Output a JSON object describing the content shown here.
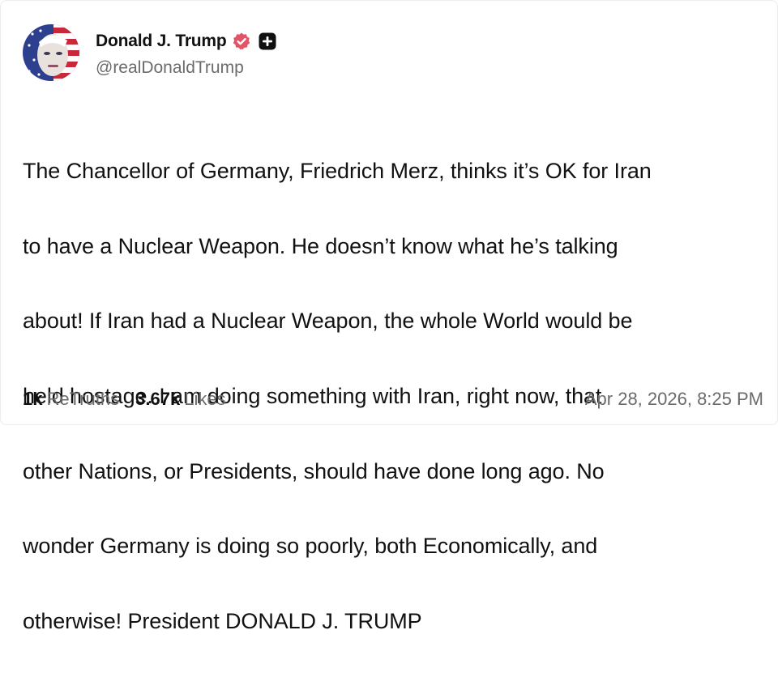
{
  "author": {
    "display_name": "Donald J. Trump",
    "handle": "@realDonaldTrump",
    "verified_badge_icon": "verified-badge-icon",
    "follow_icon": "plus-icon",
    "badge_color": "#e25569"
  },
  "post": {
    "lines": [
      "The Chancellor of Germany, Friedrich Merz, thinks it’s OK for Iran",
      "to have a Nuclear Weapon. He doesn’t know what he’s talking",
      "about! If Iran had a Nuclear Weapon, the whole World would be",
      "held hostage. I am doing something with Iran, right now, that",
      "other Nations, or Presidents, should have done long ago. No",
      "wonder Germany is doing so poorly, both Economically, and",
      "otherwise! President DONALD J. TRUMP"
    ]
  },
  "stats": {
    "retruths_count": "1k",
    "retruths_label": "ReTruths",
    "likes_count": "3.67k",
    "likes_label": "Likes"
  },
  "timestamp": "Apr 28, 2026, 8:25 PM"
}
